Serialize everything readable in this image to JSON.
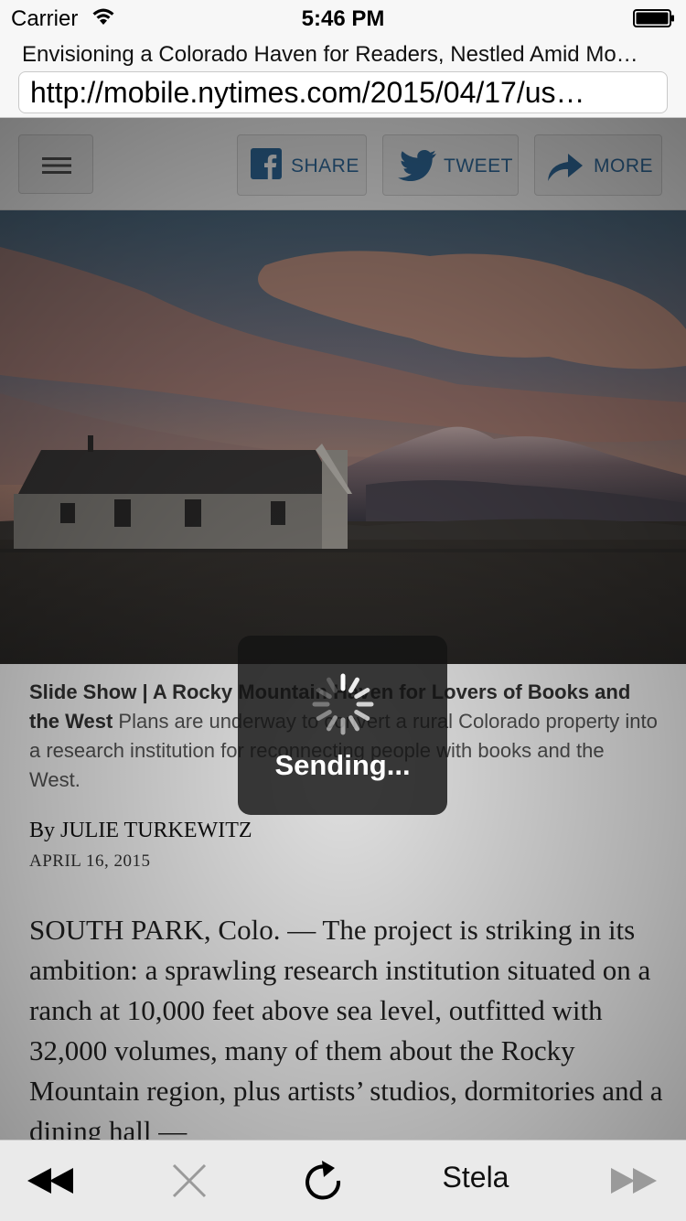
{
  "status_bar": {
    "carrier": "Carrier",
    "time": "5:46 PM"
  },
  "address_bar": {
    "page_title": "Envisioning a Colorado Haven for Readers, Nestled Amid Mo…",
    "url": "http://mobile.nytimes.com/2015/04/17/us…"
  },
  "nyt_header": {
    "share_label": "SHARE",
    "tweet_label": "TWEET",
    "more_label": "MORE"
  },
  "article": {
    "caption_kicker": "Slide Show | A Rocky Mountain Haven for Lovers of Books and the West",
    "caption_text": "Plans are underway to convert a rural Colorado property into a research institution for reconnecting people with books and the West.",
    "byline": "By JULIE TURKEWITZ",
    "date": "APRIL 16, 2015",
    "body": "SOUTH PARK, Colo. — The project is striking in its ambition: a sprawling research institution situated on a ranch at 10,000 feet above sea level, outfitted with 32,000 volumes, many of them about the Rocky Mountain region, plus artists’ studios, dormitories and a dining hall —"
  },
  "hud": {
    "text": "Sending..."
  },
  "toolbar": {
    "stela_label": "Stela"
  },
  "colors": {
    "nyt_link_blue": "#316da0",
    "hud_bg": "#141414"
  }
}
